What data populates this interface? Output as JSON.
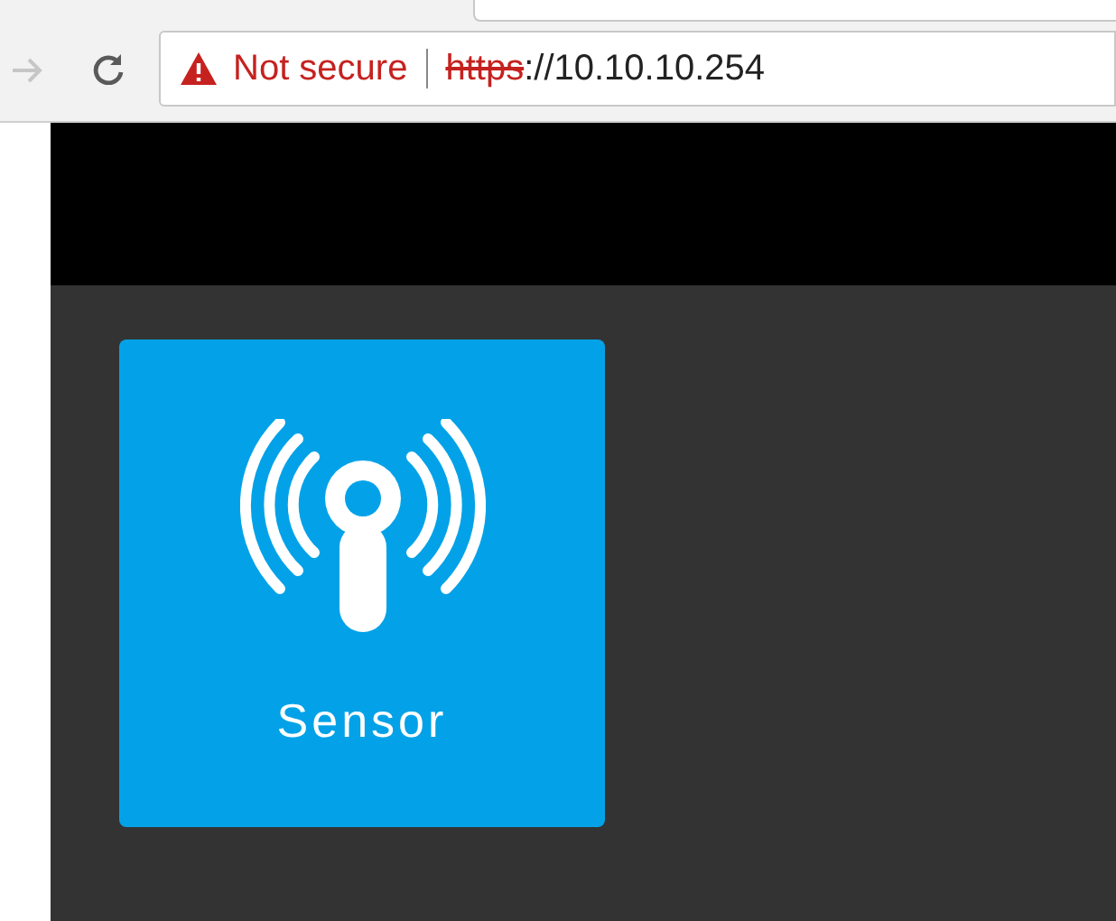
{
  "address_bar": {
    "security_label": "Not secure",
    "scheme": "https",
    "address": "://10.10.10.254"
  },
  "tiles": [
    {
      "label": "Sensor"
    }
  ]
}
